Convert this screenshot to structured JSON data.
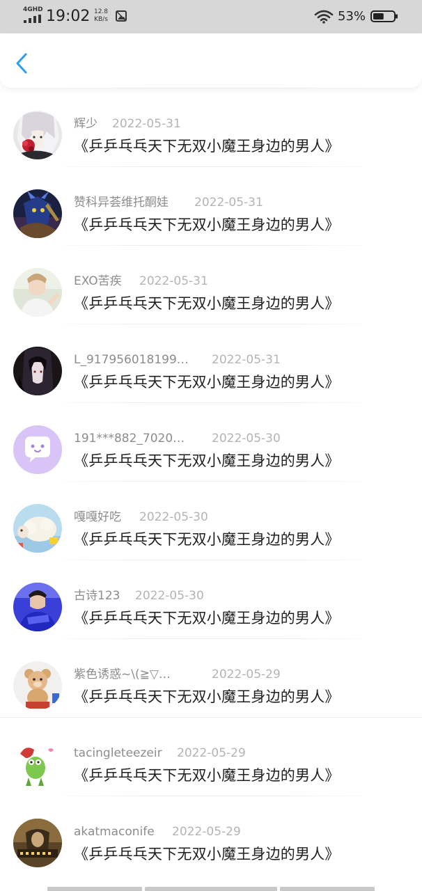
{
  "status_bar": {
    "network": "4GHD",
    "time": "19:02",
    "speed_value": "12.8",
    "speed_unit": "KB/s",
    "battery_percent": "53%",
    "battery_level": 0.53,
    "icons": [
      "signal-icon",
      "photo-notification-icon",
      "wifi-icon",
      "battery-icon"
    ]
  },
  "nav": {
    "back_icon": "chevron-left-icon",
    "accent_color": "#2d9cf0"
  },
  "items": [
    {
      "username": "辉少",
      "date": "2022-05-31",
      "title": "《乒乒乓乓天下无双小魔王身边的男人》",
      "avatar": "anime-girl-white-hair"
    },
    {
      "username": "赞科异荟维托酮娃",
      "date": "2022-05-31",
      "title": "《乒乒乓乓天下无双小魔王身边的男人》",
      "avatar": "game-character-blue"
    },
    {
      "username": "EXO苦疾",
      "date": "2022-05-31",
      "title": "《乒乒乓乓天下无双小魔王身边的男人》",
      "avatar": "person-photo-light"
    },
    {
      "username": "L_917956018199…",
      "date": "2022-05-31",
      "title": "《乒乒乓乓天下无双小魔王身边的男人》",
      "avatar": "anime-dark-hair"
    },
    {
      "username": "191***882_7020…",
      "date": "2022-05-30",
      "title": "《乒乒乓乓天下无双小魔王身边的男人》",
      "avatar": "default-chat-bubble-purple"
    },
    {
      "username": "嘎嘎好吃",
      "date": "2022-05-30",
      "title": "《乒乒乓乓天下无双小魔王身边的男人》",
      "avatar": "cartoon-sheep"
    },
    {
      "username": "古诗123",
      "date": "2022-05-30",
      "title": "《乒乒乓乓天下无双小魔王身边的男人》",
      "avatar": "person-blue-shirt"
    },
    {
      "username": "紫色诱惑~\\(≧▽…",
      "date": "2022-05-29",
      "title": "《乒乒乓乓天下无双小魔王身边的男人》",
      "avatar": "teddy-bear"
    },
    {
      "username": "tacingleteezeir",
      "date": "2022-05-29",
      "title": "《乒乒乓乓天下无双小魔王身边的男人》",
      "avatar": "cartoon-frog"
    },
    {
      "username": "akatmaconife",
      "date": "2022-05-29",
      "title": "《乒乒乓乓天下无双小魔王身边的男人》",
      "avatar": "sepia-photo-with-text"
    }
  ]
}
